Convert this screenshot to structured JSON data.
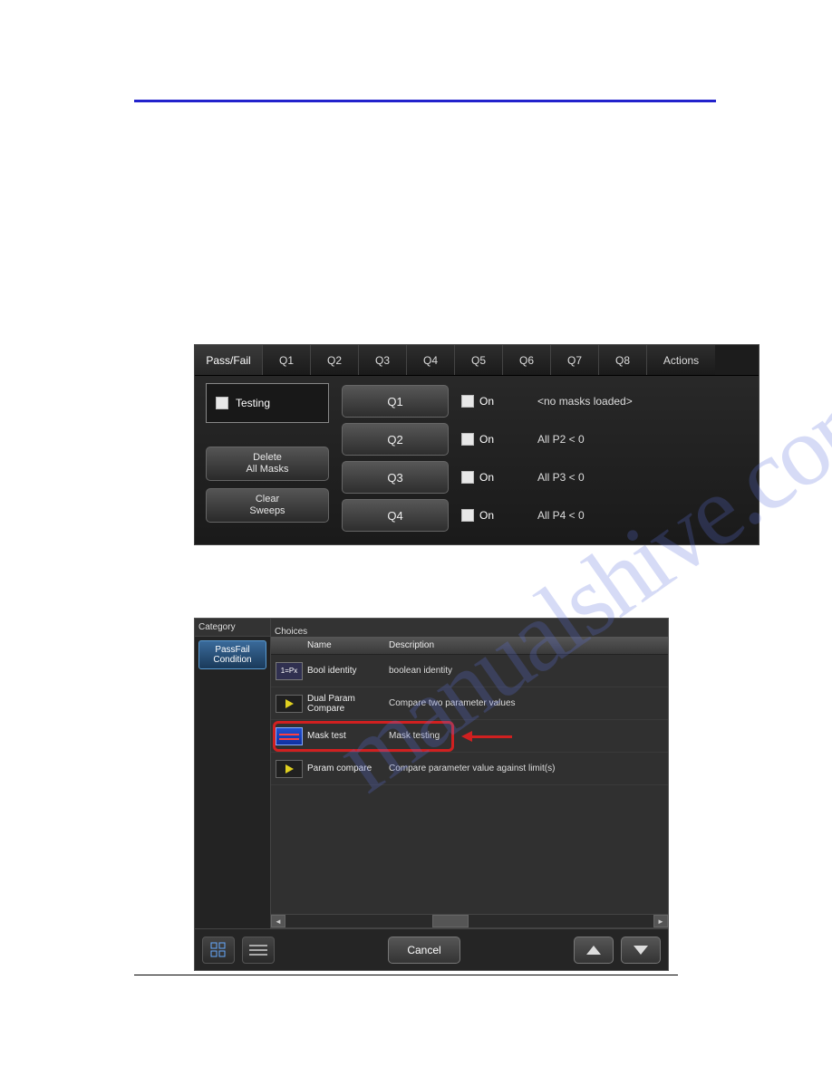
{
  "watermark": "manualshive.com",
  "panel1": {
    "tabs": [
      "Pass/Fail",
      "Q1",
      "Q2",
      "Q3",
      "Q4",
      "Q5",
      "Q6",
      "Q7",
      "Q8",
      "Actions"
    ],
    "testing_label": "Testing",
    "delete_btn_l1": "Delete",
    "delete_btn_l2": "All Masks",
    "clear_btn_l1": "Clear",
    "clear_btn_l2": "Sweeps",
    "rows": [
      {
        "q": "Q1",
        "on": "On",
        "status": "<no masks loaded>"
      },
      {
        "q": "Q2",
        "on": "On",
        "status": "All P2 < 0"
      },
      {
        "q": "Q3",
        "on": "On",
        "status": "All P3 < 0"
      },
      {
        "q": "Q4",
        "on": "On",
        "status": "All P4 < 0"
      }
    ]
  },
  "panel2": {
    "category_label": "Category",
    "choices_label": "Choices",
    "category_btn_l1": "PassFail",
    "category_btn_l2": "Condition",
    "col_name": "Name",
    "col_desc": "Description",
    "items": [
      {
        "icon": "bool",
        "name": "Bool identity",
        "desc": "boolean identity"
      },
      {
        "icon": "tri",
        "name": "Dual Param Compare",
        "desc": "Compare two parameter values"
      },
      {
        "icon": "mask",
        "name": "Mask test",
        "desc": "Mask testing",
        "highlighted": true
      },
      {
        "icon": "tri",
        "name": "Param compare",
        "desc": "Compare parameter value against limit(s)"
      }
    ],
    "cancel": "Cancel",
    "icon_bool_text": "1=Px"
  }
}
